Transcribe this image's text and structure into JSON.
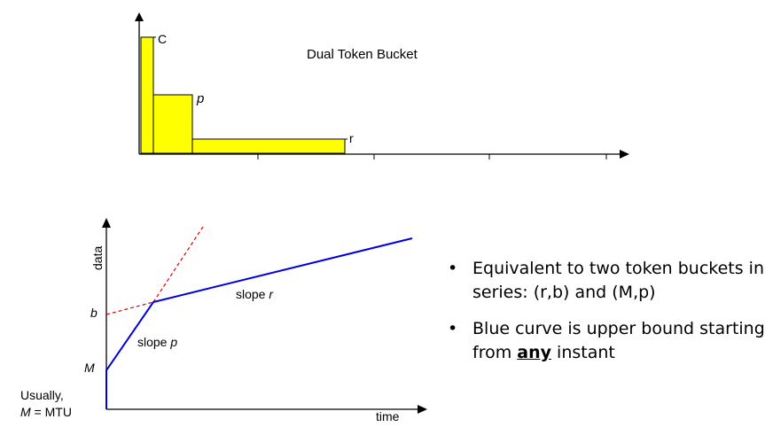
{
  "top_diagram": {
    "title": "Dual Token Bucket",
    "labels": {
      "c": "C",
      "p": "p",
      "r": "r"
    },
    "fill_color": "#ffff00"
  },
  "bottom_chart": {
    "ylabel": "data",
    "xlabel": "time",
    "label_b": "b",
    "label_m": "M",
    "slope_p": {
      "text": "slope ",
      "var": "p"
    },
    "slope_r": {
      "text": "slope ",
      "var": "r"
    },
    "note_line1": "Usually,",
    "note_m": "M",
    "note_rest": " = MTU",
    "curve_color": "#0000dd",
    "dashed_color": "#dd0000"
  },
  "bullets": [
    {
      "text": "Equivalent to two token buckets in series: (r,b) and (M,p)"
    },
    {
      "before": "Blue curve is upper bound starting from ",
      "emph": "any",
      "after": " instant"
    }
  ]
}
